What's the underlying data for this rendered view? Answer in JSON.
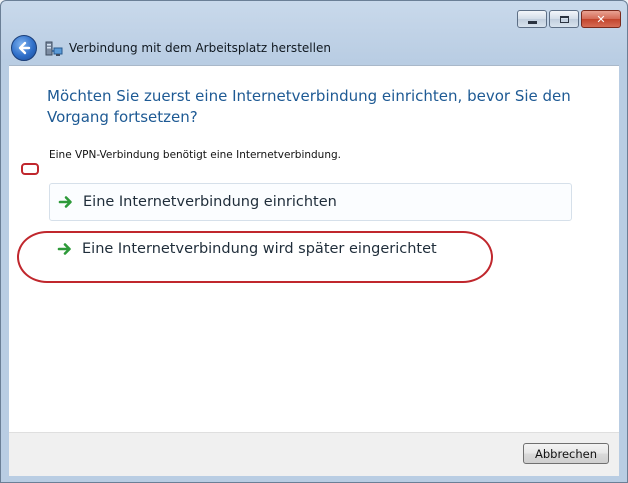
{
  "window": {
    "title": "Verbindung mit dem Arbeitsplatz herstellen",
    "caption_min": "",
    "caption_max": "",
    "caption_close": "✕"
  },
  "content": {
    "heading": "Möchten Sie zuerst eine Internetverbindung einrichten, bevor Sie den Vorgang fortsetzen?",
    "info": "Eine VPN-Verbindung benötigt eine Internetverbindung.",
    "options": [
      {
        "label": "Eine Internetverbindung einrichten"
      },
      {
        "label": "Eine Internetverbindung wird später eingerichtet"
      }
    ]
  },
  "footer": {
    "cancel_label": "Abbrechen"
  },
  "colors": {
    "heading": "#1e5a94",
    "arrow": "#2e9a3a",
    "annotation": "#c0272d"
  },
  "icons": {
    "back": "back-arrow-icon",
    "nav": "network-connection-icon",
    "option_arrow": "green-arrow-icon"
  }
}
